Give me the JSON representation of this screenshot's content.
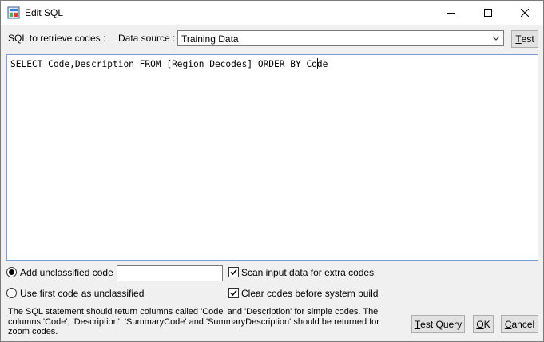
{
  "window": {
    "title": "Edit SQL",
    "app_icon": "sql-edit-icon"
  },
  "titlebar_buttons": {
    "minimize_icon": "minimize-icon",
    "maximize_icon": "maximize-icon",
    "close_icon": "close-icon"
  },
  "header": {
    "sql_label": "SQL to retrieve codes :",
    "datasource_label": "Data source :",
    "datasource_value": "Training Data",
    "test_button_prefix": "",
    "test_button_underlined": "T",
    "test_button_rest": "est"
  },
  "editor": {
    "sql": "SELECT Code,Description FROM [Region Decodes] ORDER BY Code"
  },
  "options": {
    "add_unclassified_label": "Add unclassified code",
    "add_unclassified_selected": true,
    "unclassified_code_value": "",
    "use_first_code_label": "Use first code as unclassified",
    "use_first_code_selected": false,
    "scan_input_label": "Scan input data for extra codes",
    "scan_input_checked": true,
    "clear_codes_label": "Clear codes before system build",
    "clear_codes_checked": true
  },
  "info": {
    "text": "The SQL statement should return columns called 'Code' and 'Description' for simple codes.  The columns 'Code', 'Description', 'SummaryCode' and 'SummaryDescription' should be returned for zoom codes."
  },
  "footer_buttons": {
    "test_query_underlined": "T",
    "test_query_rest": "est Query",
    "ok_underlined": "O",
    "ok_rest": "K",
    "cancel_underlined": "C",
    "cancel_rest": "ancel"
  }
}
